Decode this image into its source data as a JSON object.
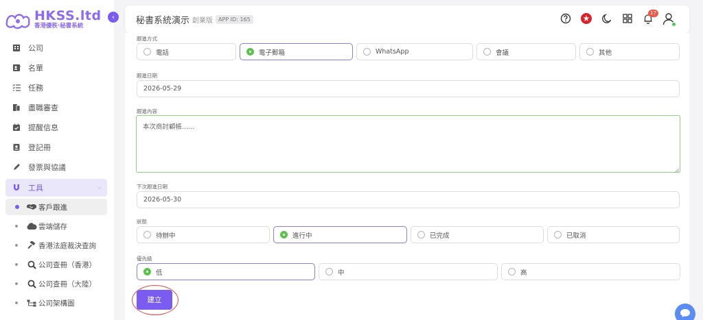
{
  "brand": {
    "name": "HKSS.ltd",
    "tagline": "香港優秩·秘書系統",
    "accent": "#7b5cf0"
  },
  "sidebar": {
    "items": [
      {
        "label": "公司",
        "icon": "building-icon"
      },
      {
        "label": "名單",
        "icon": "contact-card-icon"
      },
      {
        "label": "任務",
        "icon": "checklist-icon"
      },
      {
        "label": "盡職審查",
        "icon": "documents-icon"
      },
      {
        "label": "提醒信息",
        "icon": "calendar-check-icon"
      },
      {
        "label": "登記冊",
        "icon": "register-book-icon"
      },
      {
        "label": "發票與協議",
        "icon": "pen-icon"
      }
    ],
    "active_group": {
      "label": "工具",
      "icon": "magnet-icon"
    },
    "sub_items": [
      {
        "label": "客戶跟進",
        "icon": "handshake-icon",
        "active": true
      },
      {
        "label": "雲端儲存",
        "icon": "cloud-icon"
      },
      {
        "label": "香港法庭裁決查詢",
        "icon": "gavel-icon"
      },
      {
        "label": "公司查冊（香港）",
        "icon": "search-icon"
      },
      {
        "label": "公司查冊（大陸）",
        "icon": "search-icon"
      },
      {
        "label": "公司架構圖",
        "icon": "org-chart-icon"
      }
    ]
  },
  "header": {
    "title": "秘書系統演示",
    "edition": "創業版",
    "app_id": "APP ID: 165",
    "notification_count": "17"
  },
  "form": {
    "follow_method": {
      "label": "跟進方式",
      "options": [
        "電話",
        "電子郵箱",
        "WhatsApp",
        "會議",
        "其他"
      ],
      "selected": "電子郵箱"
    },
    "follow_date": {
      "label": "跟進日期",
      "value": "2026-05-29"
    },
    "follow_content": {
      "label": "跟進內容",
      "value": "本次商討顧帳......"
    },
    "next_follow_date": {
      "label": "下次跟進日期",
      "value": "2026-05-30"
    },
    "status": {
      "label": "狀態",
      "options": [
        "待辦中",
        "進行中",
        "已完成",
        "已取消"
      ],
      "selected": "進行中"
    },
    "priority": {
      "label": "優先級",
      "options": [
        "低",
        "中",
        "高"
      ],
      "selected": "低"
    },
    "submit_label": "建立"
  }
}
